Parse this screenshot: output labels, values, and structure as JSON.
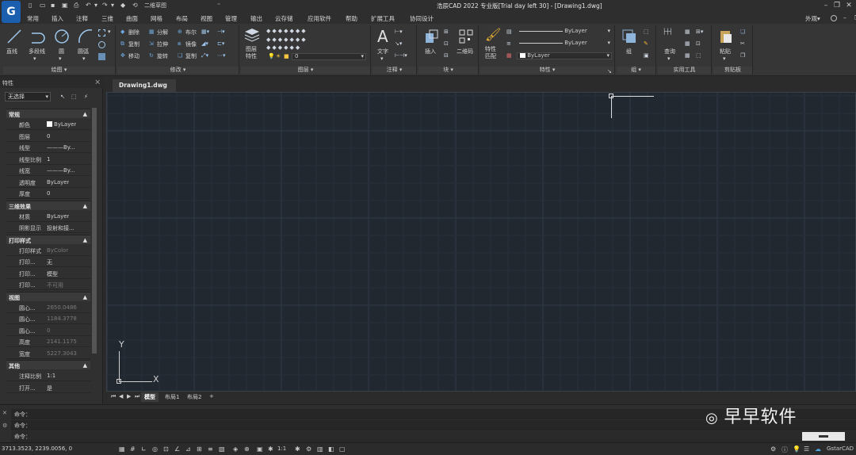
{
  "app": {
    "title": "浩辰CAD 2022 专业版[Trial day left 30] - [Drawing1.dwg]",
    "workspace": "二维草图",
    "logo_letter": "G",
    "accent_color": "#1c5fae"
  },
  "menubar": {
    "items": [
      "常用",
      "插入",
      "注释",
      "三维",
      "曲面",
      "网格",
      "布局",
      "视图",
      "管理",
      "输出",
      "云存储",
      "应用软件",
      "帮助",
      "扩展工具",
      "协同设计"
    ],
    "right_label": "外观▾"
  },
  "ribbon": {
    "draw": {
      "label": "绘图 ▾",
      "tools": [
        "直线",
        "多段线",
        "圆",
        "圆弧"
      ]
    },
    "modify": {
      "label": "修改 ▾",
      "tools": [
        "删除",
        "分解",
        "布尔",
        "复制",
        "拉伸",
        "镜像",
        "移动",
        "旋转",
        "复制"
      ]
    },
    "layers": {
      "label": "图层 ▾",
      "big_tool": "图层\n特性",
      "current_layer": "0"
    },
    "annotate": {
      "label": "注释 ▾",
      "tool": "文字"
    },
    "block": {
      "label": "块 ▾",
      "tools": [
        "插入",
        "二维码"
      ]
    },
    "properties": {
      "label": "特性 ▾",
      "big_tool": "特性\n匹配",
      "color": "ByLayer",
      "linetype": "ByLayer",
      "lineweight": "ByLayer"
    },
    "group": {
      "label": "组 ▾",
      "tool": "组"
    },
    "utilities": {
      "label": "实用工具",
      "tool": "查询"
    },
    "clipboard": {
      "label": "剪贴板",
      "tool": "粘贴"
    }
  },
  "properties_panel": {
    "title": "特性",
    "selection": "无选择",
    "sections": [
      {
        "name": "常规",
        "rows": [
          {
            "k": "颜色",
            "v": "ByLayer"
          },
          {
            "k": "图层",
            "v": "0"
          },
          {
            "k": "线型",
            "v": "———By..."
          },
          {
            "k": "线型比例",
            "v": "1"
          },
          {
            "k": "线宽",
            "v": "———By..."
          },
          {
            "k": "透明度",
            "v": "ByLayer"
          },
          {
            "k": "厚度",
            "v": "0"
          }
        ]
      },
      {
        "name": "三维效果",
        "rows": [
          {
            "k": "材质",
            "v": "ByLayer"
          },
          {
            "k": "阴影显示",
            "v": "投射和接..."
          }
        ]
      },
      {
        "name": "打印样式",
        "rows": [
          {
            "k": "打印样式",
            "v": "ByColor"
          },
          {
            "k": "打印...",
            "v": "无"
          },
          {
            "k": "打印...",
            "v": "模型"
          },
          {
            "k": "打印...",
            "v": "不可用"
          }
        ]
      },
      {
        "name": "视图",
        "rows": [
          {
            "k": "圆心...",
            "v": "2650.0486"
          },
          {
            "k": "圆心...",
            "v": "1184.3778"
          },
          {
            "k": "圆心...",
            "v": "0"
          },
          {
            "k": "高度",
            "v": "2141.1175"
          },
          {
            "k": "宽度",
            "v": "5227.3043"
          }
        ]
      },
      {
        "name": "其他",
        "rows": [
          {
            "k": "注释比例",
            "v": "1:1"
          },
          {
            "k": "打开...",
            "v": "是"
          }
        ]
      }
    ]
  },
  "document": {
    "tab": "Drawing1.dwg"
  },
  "canvas": {
    "background": "#212830",
    "ucs_x": "X",
    "ucs_y": "Y"
  },
  "layout_tabs": [
    "模型",
    "布局1",
    "布局2",
    "+"
  ],
  "command": {
    "lines": [
      "命令：",
      "命令：",
      "命令："
    ]
  },
  "status": {
    "coords": "3713.3523, 2239.0056, 0",
    "scale": "1:1",
    "brand": "GstarCAD"
  },
  "watermark": {
    "text": "早早软件"
  }
}
